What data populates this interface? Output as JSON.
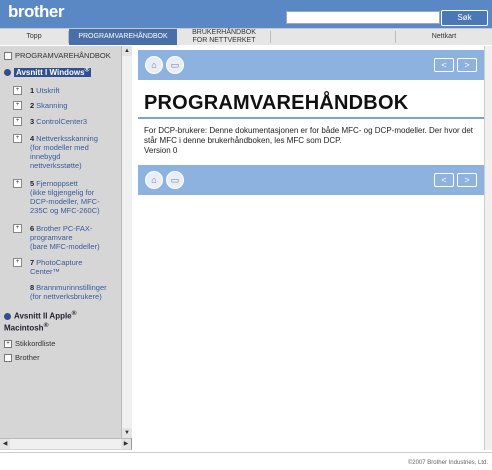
{
  "header": {
    "logo": "brother",
    "search_placeholder": "",
    "search_button": "Søk"
  },
  "tabs": [
    {
      "label": "Topp"
    },
    {
      "label": "PROGRAMVAREHÅNDBOK"
    },
    {
      "label": "BRUKERHÅNDBOK\nFOR NETTVERKET"
    },
    {
      "label": "Nettkart"
    }
  ],
  "sidebar": {
    "root_label": "PROGRAMVAREHÅNDBOK",
    "section1": {
      "label": "Avsnitt I Windows",
      "sup": "®"
    },
    "items": [
      {
        "num": "1",
        "label": "Utskrift"
      },
      {
        "num": "2",
        "label": "Skanning"
      },
      {
        "num": "3",
        "label": "ControlCenter3"
      },
      {
        "num": "4",
        "label": "Nettverksskanning",
        "sub": [
          "(for modeller med",
          "innebygd",
          "nettverksstøtte)"
        ]
      },
      {
        "num": "5",
        "label": "Fjernoppsett",
        "sub": [
          "(ikke tilgjengelig for",
          "DCP-modeller, MFC-",
          "235C og MFC-260C)"
        ]
      },
      {
        "num": "6",
        "label": "Brother PC-FAX-",
        "sub": [
          "programvare",
          "(bare MFC-modeller)"
        ]
      },
      {
        "num": "7",
        "label": "PhotoCapture",
        "sub": [
          "Center™"
        ]
      },
      {
        "num": "8",
        "label": "Brannmurinnstillinger",
        "sub": [
          "(for nettverksbrukere)"
        ]
      }
    ],
    "section2": {
      "label": "Avsnitt II Apple",
      "sup": "®",
      "label2": "Macintosh",
      "sup2": "®"
    },
    "index_label": "Stikkordliste",
    "brother_label": "Brother"
  },
  "main": {
    "title": "PROGRAMVAREHÅNDBOK",
    "body_line1": "For DCP-brukere: Denne dokumentasjonen er for både MFC- og DCP-modeller. Der hvor det står MFC i denne brukerhåndboken, les MFC som DCP.",
    "version": "Version 0"
  },
  "footer": {
    "copyright": "©2007 Brother Industries, Ltd."
  },
  "colors": {
    "header": "#5a88c4",
    "nav_band": "#8eb2e0",
    "active_tab": "#4a6fa8"
  }
}
